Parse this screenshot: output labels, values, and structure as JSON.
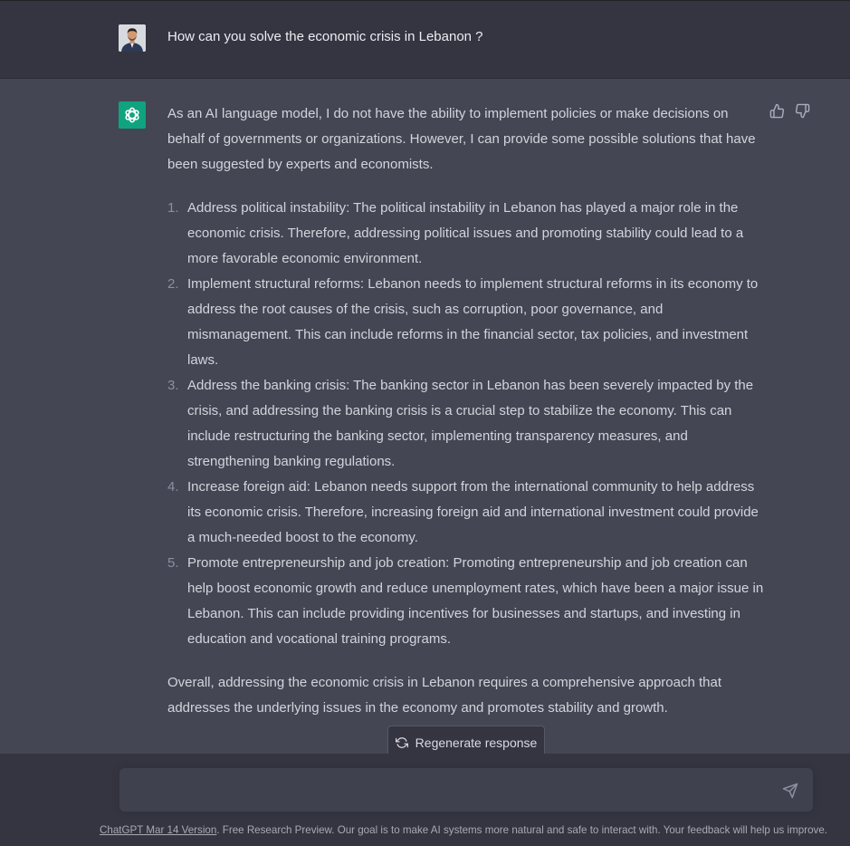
{
  "user_message": {
    "text": "How can you solve the economic crisis in Lebanon ?"
  },
  "assistant_message": {
    "intro": "As an AI language model, I do not have the ability to implement policies or make decisions on behalf of governments or organizations. However, I can provide some possible solutions that have been suggested by experts and economists.",
    "items": [
      {
        "num": "1.",
        "text": "Address political instability: The political instability in Lebanon has played a major role in the economic crisis. Therefore, addressing political issues and promoting stability could lead to a more favorable economic environment."
      },
      {
        "num": "2.",
        "text": "Implement structural reforms: Lebanon needs to implement structural reforms in its economy to address the root causes of the crisis, such as corruption, poor governance, and mismanagement. This can include reforms in the financial sector, tax policies, and investment laws."
      },
      {
        "num": "3.",
        "text": "Address the banking crisis: The banking sector in Lebanon has been severely impacted by the crisis, and addressing the banking crisis is a crucial step to stabilize the economy. This can include restructuring the banking sector, implementing transparency measures, and strengthening banking regulations."
      },
      {
        "num": "4.",
        "text": "Increase foreign aid: Lebanon needs support from the international community to help address its economic crisis. Therefore, increasing foreign aid and international investment could provide a much-needed boost to the economy."
      },
      {
        "num": "5.",
        "text": "Promote entrepreneurship and job creation: Promoting entrepreneurship and job creation can help boost economic growth and reduce unemployment rates, which have been a major issue in Lebanon. This can include providing incentives for businesses and startups, and investing in education and vocational training programs."
      }
    ],
    "conclusion": "Overall, addressing the economic crisis in Lebanon requires a comprehensive approach that addresses the underlying issues in the economy and promotes stability and growth."
  },
  "regenerate": {
    "label": "Regenerate response"
  },
  "input": {
    "value": "",
    "placeholder": ""
  },
  "footer": {
    "version_link": "ChatGPT Mar 14 Version",
    "text": ". Free Research Preview. Our goal is to make AI systems more natural and safe to interact with. Your feedback will help us improve."
  },
  "icons": {
    "assistant_avatar": "openai-logo-icon",
    "thumbs_up": "thumbs-up-icon",
    "thumbs_down": "thumbs-down-icon",
    "regenerate": "refresh-icon",
    "send": "send-icon"
  },
  "colors": {
    "background": "#343541",
    "assistant_background": "#444654",
    "brand_green": "#10a37f",
    "input_background": "#40414f"
  }
}
